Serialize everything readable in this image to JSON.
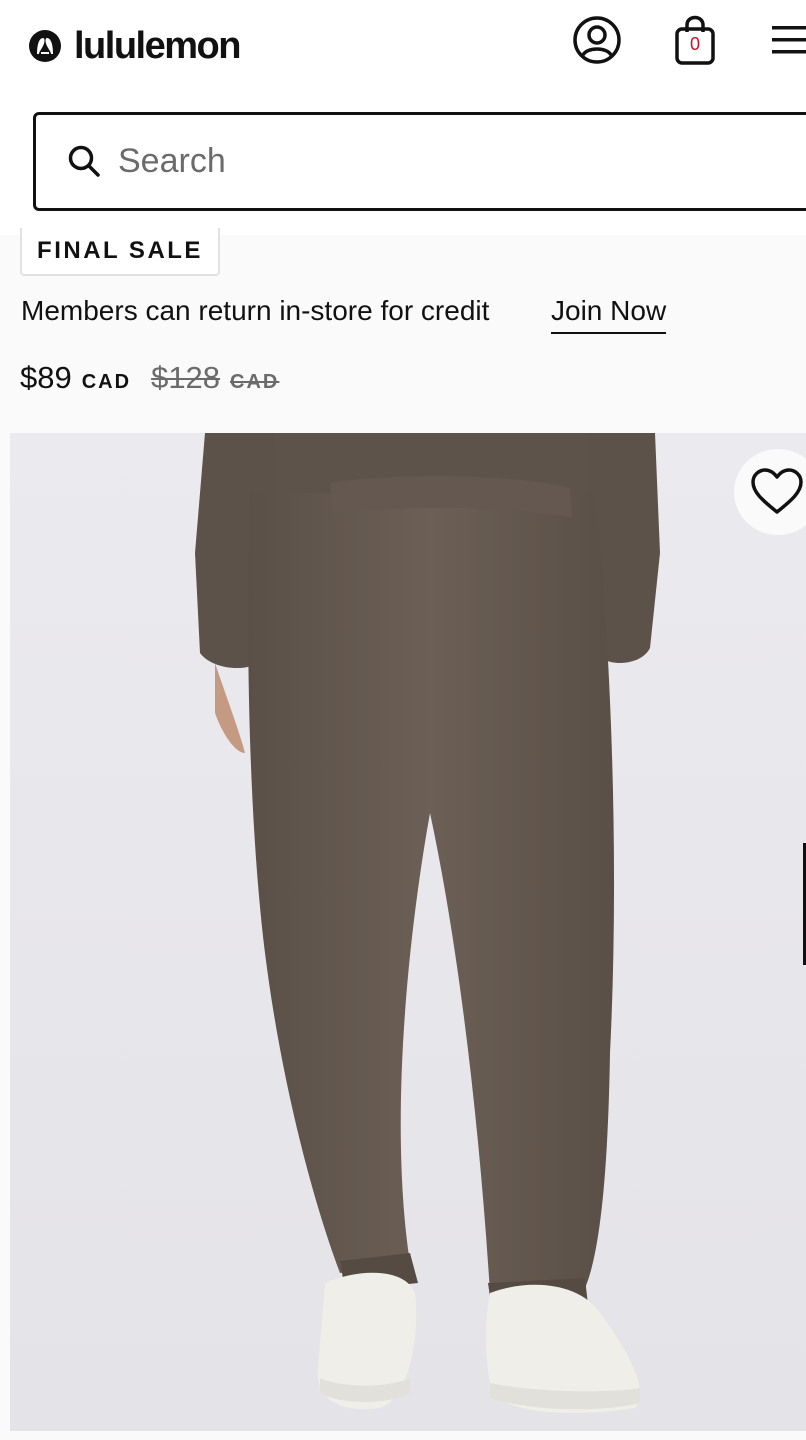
{
  "header": {
    "brand_name": "lululemon",
    "logo_icon": "lululemon-logo-icon",
    "account_icon": "account-icon",
    "bag_icon": "shopping-bag-icon",
    "bag_count": "0",
    "menu_icon": "hamburger-menu-icon"
  },
  "search": {
    "placeholder": "Search",
    "value": "",
    "icon": "search-icon"
  },
  "product": {
    "badge": "FINAL SALE",
    "member_message": "Members can return in-store for credit",
    "join_link": "Join Now",
    "price": {
      "current": "$89",
      "current_currency": "CAD",
      "original": "$128",
      "original_currency": "CAD"
    },
    "image": {
      "subject": "brown sweatpants worn with white sneakers",
      "wishlist_icon": "heart-icon"
    }
  },
  "colors": {
    "text": "#111111",
    "muted": "#6b6b6b",
    "bag_count": "#c8102e",
    "page_bg": "#fafafa",
    "image_bg": "#e9e8ec",
    "pants": "#655a51"
  }
}
